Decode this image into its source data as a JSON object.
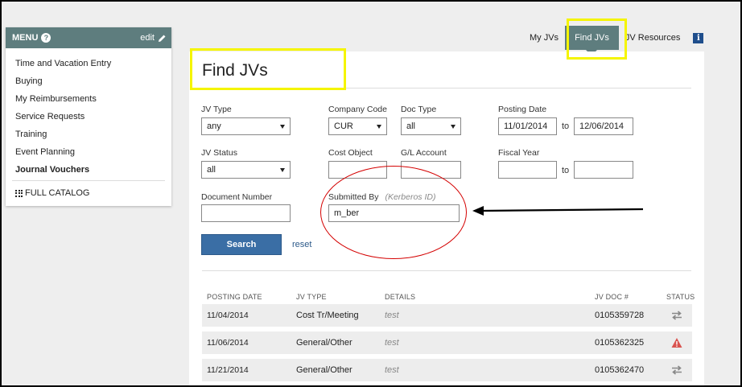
{
  "sidebar": {
    "header": "MENU",
    "help": "?",
    "edit": "edit",
    "items": [
      {
        "label": "Time and Vacation Entry"
      },
      {
        "label": "Buying"
      },
      {
        "label": "My Reimbursements"
      },
      {
        "label": "Service Requests"
      },
      {
        "label": "Training"
      },
      {
        "label": "Event Planning"
      },
      {
        "label": "Journal Vouchers"
      }
    ],
    "catalog": "FULL CATALOG"
  },
  "tabs": {
    "my_jvs": "My JVs",
    "find_jvs": "Find JVs",
    "jv_resources": "JV Resources",
    "info": "i"
  },
  "page_title": "Find JVs",
  "form": {
    "jv_type": {
      "label": "JV Type",
      "value": "any"
    },
    "company_code": {
      "label": "Company Code",
      "value": "CUR"
    },
    "doc_type": {
      "label": "Doc Type",
      "value": "all"
    },
    "posting_date": {
      "label": "Posting Date",
      "from": "11/01/2014",
      "to_label": "to",
      "to": "12/06/2014"
    },
    "jv_status": {
      "label": "JV Status",
      "value": "all"
    },
    "cost_object": {
      "label": "Cost Object",
      "value": ""
    },
    "gl_account": {
      "label": "G/L Account",
      "value": ""
    },
    "fiscal_year": {
      "label": "Fiscal Year",
      "from": "",
      "to_label": "to",
      "to": ""
    },
    "document_number": {
      "label": "Document Number",
      "value": ""
    },
    "submitted_by": {
      "label": "Submitted By",
      "hint": "(Kerberos ID)",
      "value": "m_ber"
    },
    "search_button": "Search",
    "reset_link": "reset"
  },
  "table": {
    "headers": {
      "posting_date": "POSTING DATE",
      "jv_type": "JV TYPE",
      "details": "DETAILS",
      "jv_doc": "JV DOC #",
      "status": "STATUS"
    },
    "rows": [
      {
        "posting_date": "11/04/2014",
        "jv_type": "Cost Tr/Meeting",
        "details": "test",
        "jv_doc": "0105359728",
        "status": "transfer-icon"
      },
      {
        "posting_date": "11/06/2014",
        "jv_type": "General/Other",
        "details": "test",
        "jv_doc": "0105362325",
        "status": "warning-icon"
      },
      {
        "posting_date": "11/21/2014",
        "jv_type": "General/Other",
        "details": "test",
        "jv_doc": "0105362470",
        "status": "transfer-icon"
      }
    ]
  },
  "colors": {
    "menu_header": "#5e7d7e",
    "primary_button": "#3a6ea5",
    "highlight_box": "#f5f500",
    "annotation_red": "#d40000"
  }
}
